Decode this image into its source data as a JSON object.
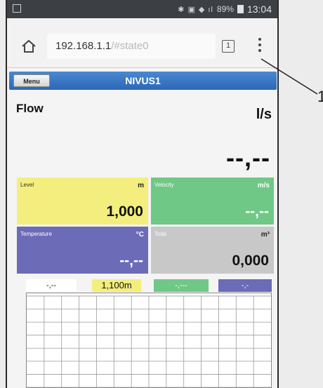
{
  "statusbar": {
    "battery": "89%",
    "time": "13:04"
  },
  "browser": {
    "url_host": "192.168.1.1",
    "url_hash": "/#state0",
    "tab_count": "1"
  },
  "app": {
    "menu_label": "Menu",
    "title": "NIVUS1"
  },
  "flow": {
    "label": "Flow",
    "unit": "l/s",
    "value": "--,--"
  },
  "tiles": {
    "level": {
      "label": "Level",
      "unit": "m",
      "value": "1,000"
    },
    "velocity": {
      "label": "Velocity",
      "unit": "m/s",
      "value": "--,--"
    },
    "temperature": {
      "label": "Temperature",
      "unit": "°C",
      "value": "--,--"
    },
    "total": {
      "label": "Total",
      "unit": "m³",
      "value": "0,000"
    }
  },
  "chart_legend": [
    "-,--",
    "1,100m",
    "-,---",
    "-,-"
  ],
  "colors": {
    "appbar": "#2c67b6",
    "level": "#f3ee7e",
    "velocity": "#6fc886",
    "temperature": "#6b6bb8",
    "total": "#c8c8c8"
  },
  "callout": "1"
}
